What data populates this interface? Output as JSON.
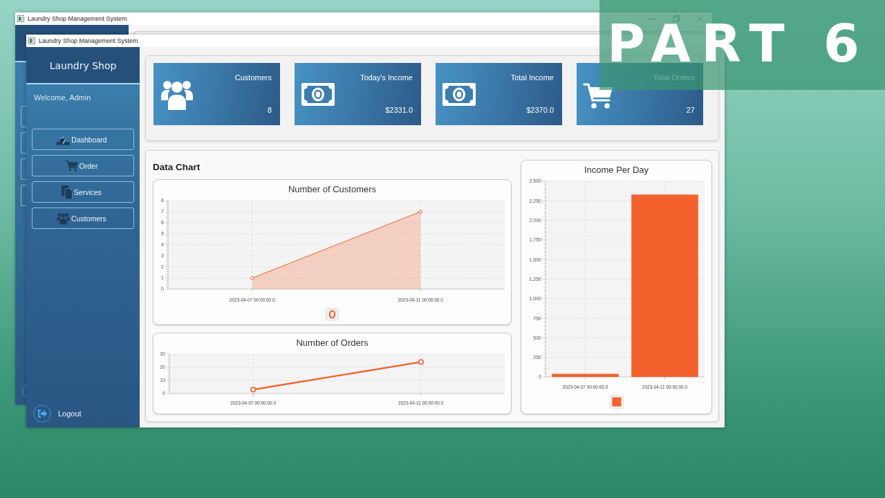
{
  "banner": {
    "text": "PART 6"
  },
  "back_window": {
    "title": "Laundry Shop Management System"
  },
  "window": {
    "title": "Laundry Shop Management System"
  },
  "sidebar": {
    "brand": "Laundry Shop",
    "welcome": "Welcome, Admin",
    "items": [
      {
        "label": "Dashboard"
      },
      {
        "label": "Order"
      },
      {
        "label": "Services"
      },
      {
        "label": "Customers"
      }
    ],
    "logout": "Logout"
  },
  "stats": [
    {
      "label": "Customers",
      "value": "8"
    },
    {
      "label": "Today's Income",
      "value": "$2331.0"
    },
    {
      "label": "Total Income",
      "value": "$2370.0"
    },
    {
      "label": "Total Orders",
      "value": "27"
    }
  ],
  "data_chart": {
    "title": "Data Chart",
    "charts": [
      {
        "legend_marker": true,
        "chart_data": {
          "type": "area",
          "title": "Number of Customers",
          "categories": [
            "2023-04-07 00:00:00.0",
            "2023-04-11 00:00:00.0"
          ],
          "values": [
            1,
            7
          ],
          "color": "#f3622d",
          "ylim": [
            0,
            8
          ],
          "yticks": [
            0,
            1,
            2,
            3,
            4,
            5,
            6,
            7,
            8
          ],
          "grid": true,
          "marker": "circle"
        }
      },
      {
        "chart_data": {
          "type": "line",
          "title": "Number of Orders",
          "categories": [
            "2023-04-07 00:00:00.0",
            "2023-04-11 00:00:00.0"
          ],
          "values": [
            3,
            24
          ],
          "color": "#f3622d",
          "ylim": [
            0,
            30
          ],
          "yticks": [
            0,
            10,
            20,
            30
          ],
          "grid": true,
          "marker": "circle"
        }
      },
      {
        "legend_marker": true,
        "chart_data": {
          "type": "bar",
          "title": "Income Per Day",
          "categories": [
            "2023-04-07 00:00:00.0",
            "2023-04-11 00:00:00.0"
          ],
          "values": [
            40,
            2330
          ],
          "color": "#f3622d",
          "ylim": [
            0,
            2500
          ],
          "yticks": [
            0,
            250,
            500,
            750,
            {
              "value": 1000,
              "label": "1,000"
            },
            {
              "value": 1250,
              "label": "1,250"
            },
            {
              "value": 1500,
              "label": "1,500"
            },
            {
              "value": 1750,
              "label": "1,750"
            },
            {
              "value": 2000,
              "label": "2,000"
            },
            {
              "value": 2250,
              "label": "2,250"
            },
            {
              "value": 2500,
              "label": "2,500"
            }
          ],
          "grid": true
        }
      }
    ]
  }
}
